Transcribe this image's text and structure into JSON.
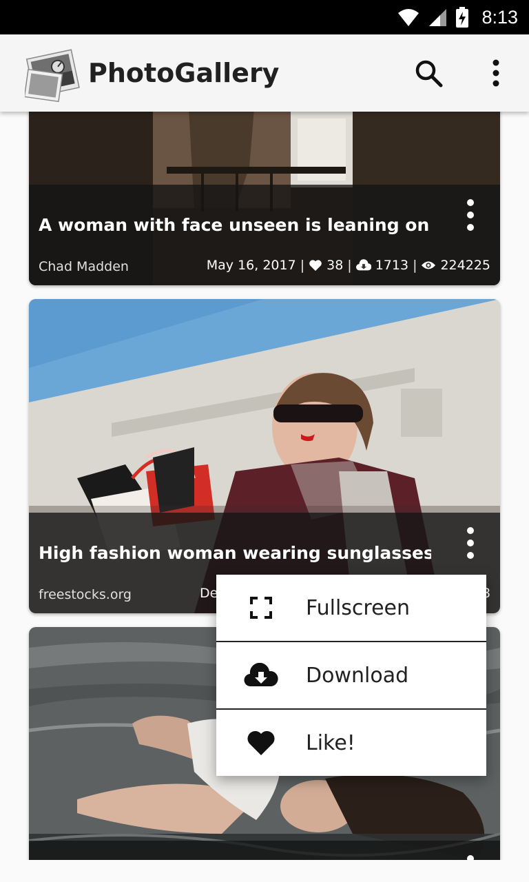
{
  "status_bar": {
    "time": "8:13",
    "icons": [
      "wifi-icon",
      "cell-signal-icon",
      "battery-charging-icon"
    ]
  },
  "app_bar": {
    "title": "PhotoGallery",
    "actions": [
      "search-icon",
      "more-vert-icon"
    ]
  },
  "cards": [
    {
      "title": "A woman with face unseen is leaning on a…",
      "author": "Chad Madden",
      "date": "May 16, 2017",
      "likes": "38",
      "downloads": "1713",
      "views": "224225"
    },
    {
      "title": "High fashion woman wearing sunglasses wit…",
      "author": "freestocks.org",
      "date_partial": "De",
      "views_partial": "8"
    },
    {
      "title": "",
      "author": ""
    }
  ],
  "popup_menu": {
    "items": [
      {
        "label": "Fullscreen",
        "icon": "fullscreen-icon"
      },
      {
        "label": "Download",
        "icon": "cloud-download-icon"
      },
      {
        "label": "Like!",
        "icon": "heart-icon"
      }
    ]
  },
  "colors": {
    "status_bar": "#000000",
    "app_bar": "#f5f5f5",
    "overlay": "#141414",
    "menu_bg": "#ffffff"
  }
}
